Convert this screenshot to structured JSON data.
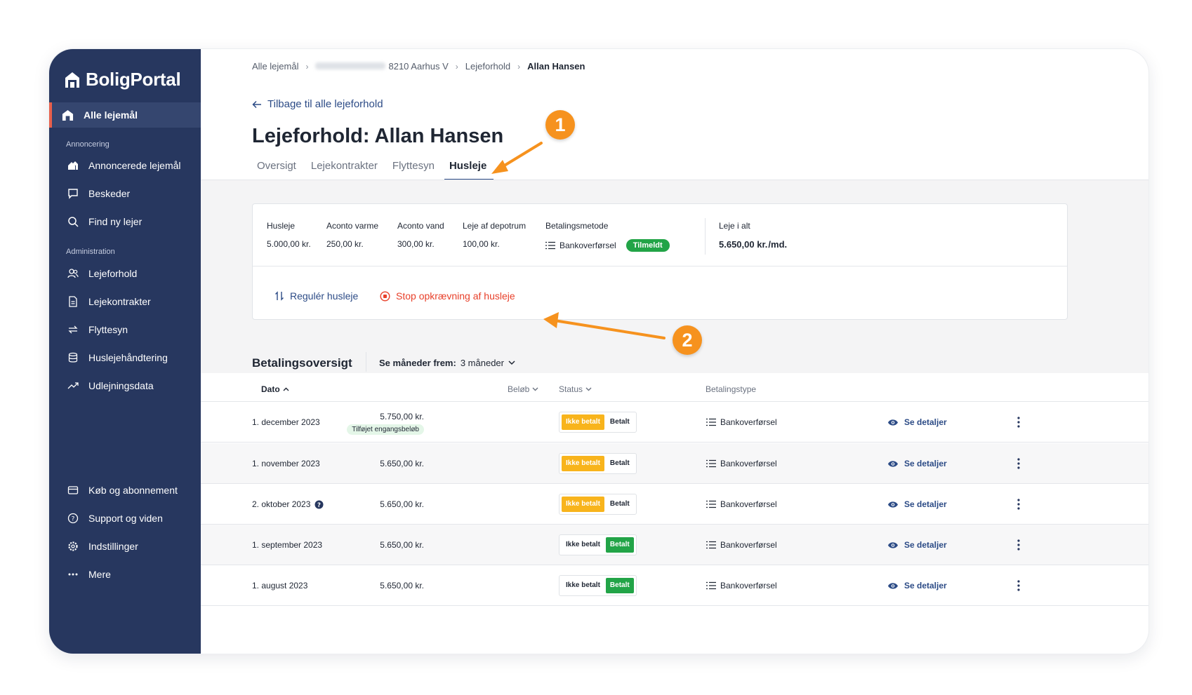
{
  "brand": {
    "name": "BoligPortal"
  },
  "sidebar": {
    "active": "Alle lejemål",
    "sections": [
      {
        "title": "Annoncering",
        "items": [
          "Annoncerede lejemål",
          "Beskeder",
          "Find ny lejer"
        ]
      },
      {
        "title": "Administration",
        "items": [
          "Lejeforhold",
          "Lejekontrakter",
          "Flyttesyn",
          "Huslejehåndtering",
          "Udlejningsdata"
        ]
      }
    ],
    "bottom": [
      "Køb og abonnement",
      "Support og viden",
      "Indstillinger",
      "Mere"
    ]
  },
  "breadcrumb": [
    "Alle lejemål",
    "8210 Aarhus V",
    "Lejeforhold",
    "Allan Hansen"
  ],
  "back_link": "Tilbage til alle lejeforhold",
  "title": {
    "prefix": "Lejeforhold:",
    "name": "Allan Hansen"
  },
  "tabs": [
    "Oversigt",
    "Lejekontrakter",
    "Flyttesyn",
    "Husleje"
  ],
  "rent": {
    "fields": [
      {
        "label": "Husleje",
        "value": "5.000,00 kr."
      },
      {
        "label": "Aconto varme",
        "value": "250,00 kr."
      },
      {
        "label": "Aconto vand",
        "value": "300,00 kr."
      },
      {
        "label": "Leje af depotrum",
        "value": "100,00 kr."
      }
    ],
    "payment_method": {
      "label": "Betalingsmetode",
      "value": "Bankoverførsel",
      "badge": "Tilmeldt"
    },
    "total": {
      "label": "Leje i alt",
      "value": "5.650,00 kr.",
      "suffix": "/md."
    },
    "actions": {
      "adjust": "Regulér husleje",
      "stop": "Stop opkrævning af husleje"
    }
  },
  "overview": {
    "title": "Betalingsoversigt",
    "filter_label": "Se måneder frem:",
    "filter_value": "3 måneder",
    "columns": {
      "date": "Dato",
      "amount": "Beløb",
      "status": "Status",
      "type": "Betalingstype"
    },
    "status_options": {
      "unpaid": "Ikke betalt",
      "paid": "Betalt"
    },
    "details_label": "Se detaljer",
    "rows": [
      {
        "date": "1. december 2023",
        "amount": "5.750,00 kr.",
        "extra": "Tilføjet engangsbeløb",
        "status": "unpaid",
        "type": "Bankoverførsel"
      },
      {
        "date": "1. november 2023",
        "amount": "5.650,00 kr.",
        "status": "unpaid",
        "type": "Bankoverførsel"
      },
      {
        "date": "2. oktober 2023",
        "amount": "5.650,00 kr.",
        "status": "unpaid",
        "type": "Bankoverførsel"
      },
      {
        "date": "1. september 2023",
        "amount": "5.650,00 kr.",
        "status": "paid",
        "type": "Bankoverførsel"
      },
      {
        "date": "1. august 2023",
        "amount": "5.650,00 kr.",
        "status": "paid",
        "type": "Bankoverførsel"
      }
    ]
  },
  "callouts": [
    "1",
    "2"
  ],
  "colors": {
    "sidebar": "#27375f",
    "accent_link": "#2c4b86",
    "danger": "#e8402a",
    "unpaid": "#f8b41c",
    "paid": "#22a447",
    "callout": "#f6921e"
  }
}
